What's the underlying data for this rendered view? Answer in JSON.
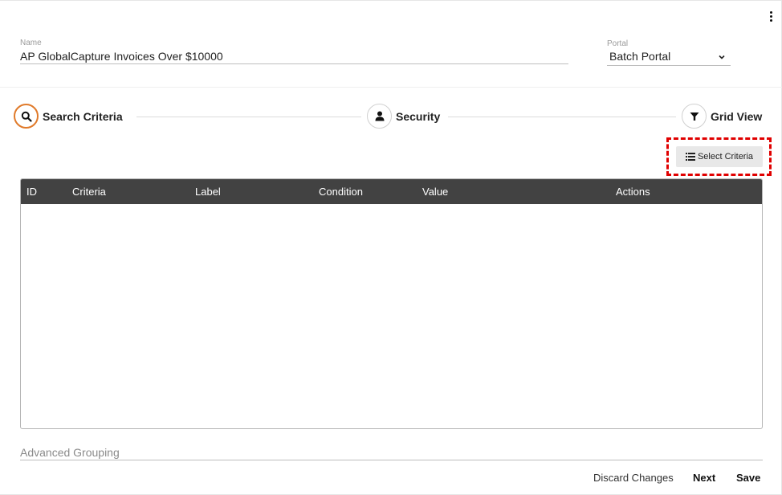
{
  "form": {
    "name_label": "Name",
    "name_value": "AP GlobalCapture Invoices Over $10000",
    "portal_label": "Portal",
    "portal_value": "Batch Portal"
  },
  "steps": [
    {
      "label": "Search Criteria",
      "icon": "search-icon",
      "active": true
    },
    {
      "label": "Security",
      "icon": "user-icon",
      "active": false
    },
    {
      "label": "Grid View",
      "icon": "filter-icon",
      "active": false
    }
  ],
  "toolbar": {
    "select_criteria_label": "Select Criteria",
    "select_criteria_icon": "list-icon",
    "highlight_color": "#e00000"
  },
  "table": {
    "columns": [
      "ID",
      "Criteria",
      "Label",
      "Condition",
      "Value",
      "Actions"
    ],
    "rows": []
  },
  "advanced_grouping_label": "Advanced Grouping",
  "footer": {
    "discard_label": "Discard Changes",
    "next_label": "Next",
    "save_label": "Save"
  },
  "colors": {
    "accent": "#e07a2a",
    "table_header": "#424242"
  }
}
